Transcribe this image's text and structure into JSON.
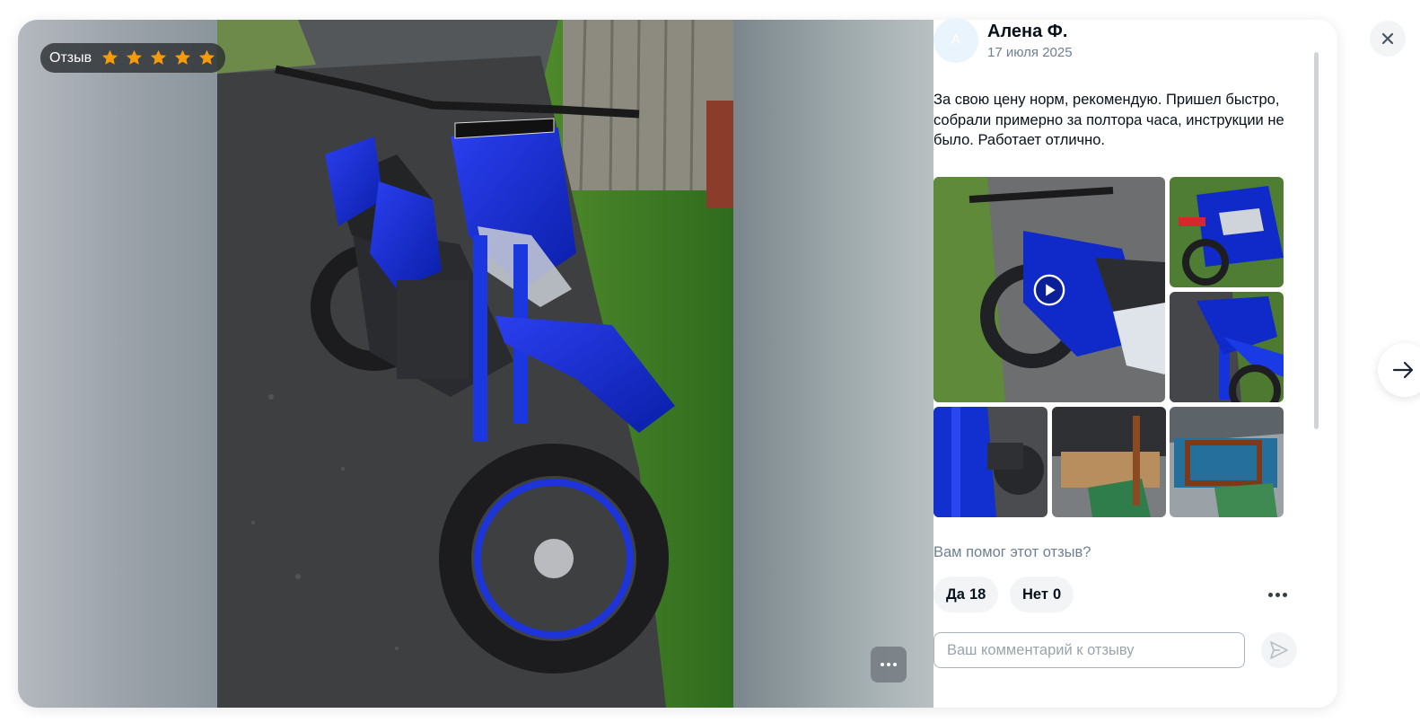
{
  "media": {
    "badge_label": "Отзыв",
    "rating": 5,
    "rating_max": 5,
    "star_color": "#f59a0a"
  },
  "review": {
    "avatar_letter": "А",
    "author": "Алена Ф.",
    "date": "17 июля 2025",
    "text": "За свою цену норм, рекомендую. Пришел быстро, собрали примерно за полтора часа, инструкции не было. Работает отлично."
  },
  "gallery": {
    "video_play_icon": "play-icon",
    "thumbnail_count": 6
  },
  "feedback": {
    "question": "Вам помог этот отзыв?",
    "yes_label": "Да",
    "yes_count": "18",
    "no_label": "Нет",
    "no_count": "0"
  },
  "comment": {
    "placeholder": "Ваш комментарий к отзыву"
  },
  "icons": {
    "close": "close-icon",
    "next": "arrow-right-icon",
    "send": "send-icon",
    "more": "more-horizontal-icon"
  },
  "colors": {
    "accent_blue": "#0a35c8",
    "text_primary": "#07111b",
    "text_secondary": "#70808f",
    "pill_bg": "#f2f4f6"
  }
}
